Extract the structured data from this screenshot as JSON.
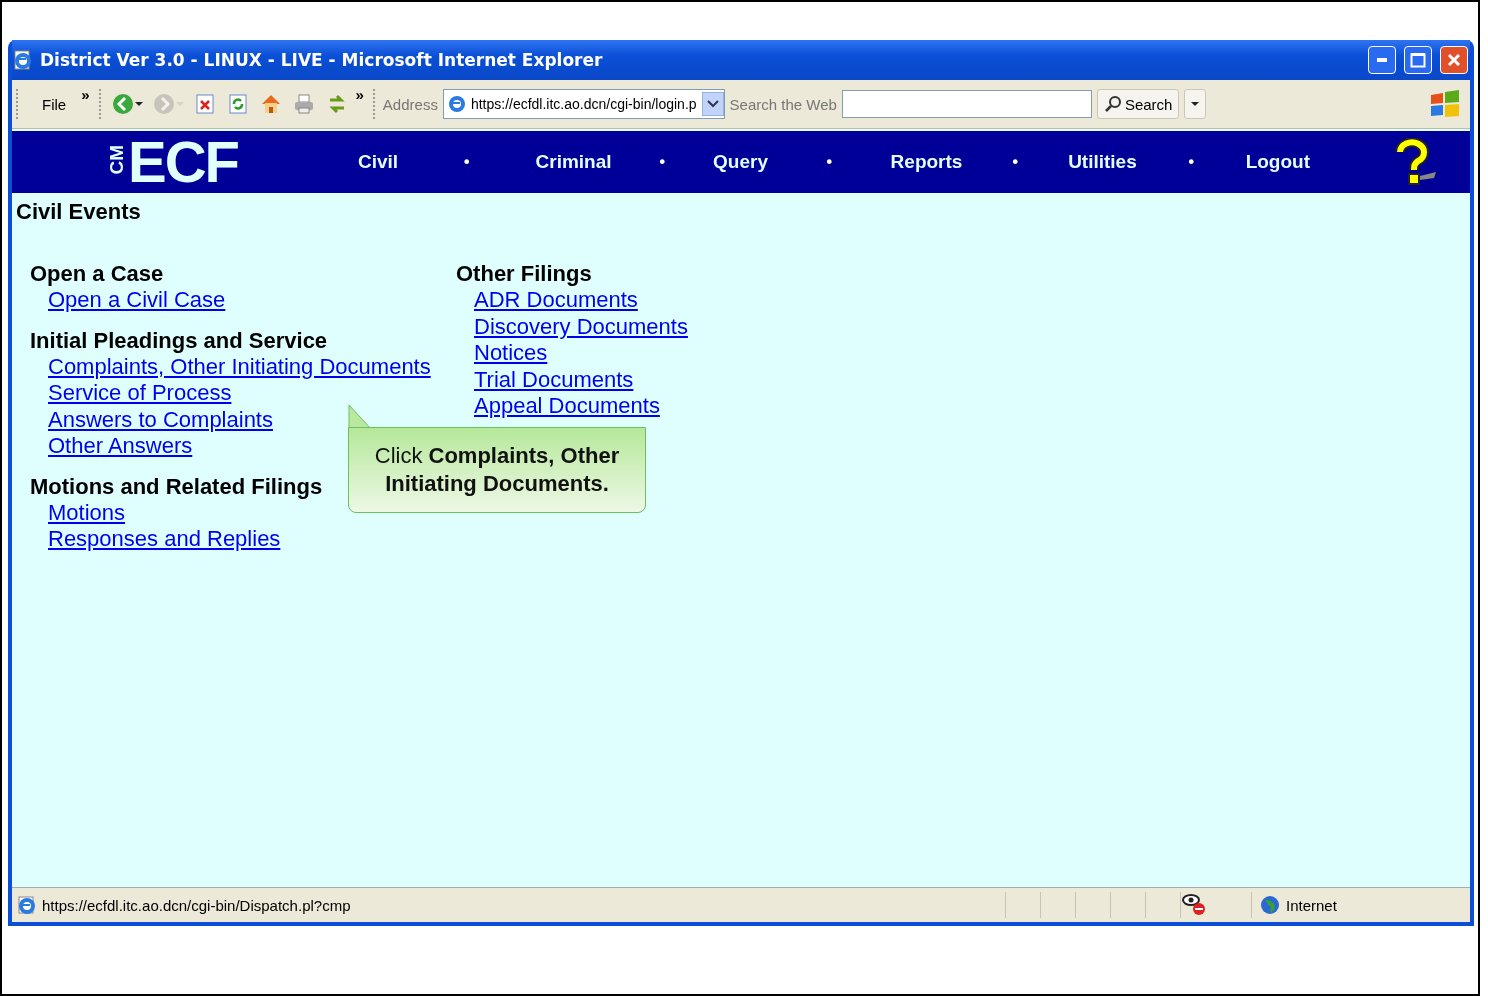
{
  "window": {
    "title": "District Ver 3.0 - LINUX - LIVE - Microsoft Internet Explorer"
  },
  "toolbar": {
    "menu": "File",
    "menu_chevron": "»",
    "buttons": [
      {
        "kind": "back",
        "disabled": false
      },
      {
        "kind": "forward",
        "disabled": true
      },
      {
        "kind": "stop",
        "disabled": false
      },
      {
        "kind": "refresh",
        "disabled": false
      },
      {
        "kind": "home",
        "disabled": false
      },
      {
        "kind": "print",
        "disabled": false
      },
      {
        "kind": "sync",
        "disabled": false
      }
    ],
    "buttons_chevron": "»",
    "address_label": "Address",
    "address": "https://ecfdl.itc.ao.dcn/cgi-bin/login.p",
    "search_label": "Search the Web",
    "search_button": "Search"
  },
  "nav": {
    "logo_prefix": "CM",
    "logo": "ECF",
    "items": [
      {
        "label": "Civil",
        "separator": "•"
      },
      {
        "label": "Criminal",
        "separator": "•"
      },
      {
        "label": "Query",
        "separator": "•"
      },
      {
        "label": "Reports",
        "separator": "•"
      },
      {
        "label": "Utilities",
        "separator": "•"
      },
      {
        "label": "Logout"
      }
    ]
  },
  "page": {
    "title": "Civil Events",
    "columns": [
      {
        "sections": [
          {
            "heading": "Open a Case",
            "links": [
              "Open a Civil Case"
            ]
          },
          {
            "heading": "Initial Pleadings and Service",
            "links": [
              "Complaints, Other Initiating Documents",
              "Service of Process",
              "Answers to Complaints",
              "Other Answers"
            ]
          },
          {
            "heading": "Motions and Related Filings",
            "links": [
              "Motions",
              "Responses and Replies"
            ]
          }
        ]
      },
      {
        "sections": [
          {
            "heading": "Other Filings",
            "links": [
              "ADR Documents",
              "Discovery Documents",
              "Notices",
              "Trial Documents",
              "Appeal Documents"
            ]
          }
        ]
      }
    ]
  },
  "callout": {
    "text": "Click **Complaints, Other Initiating Documents.**"
  },
  "status_bar": {
    "url": "https://ecfdl.itc.ao.dcn/cgi-bin/Dispatch.pl?cmp",
    "zone": "Internet"
  }
}
